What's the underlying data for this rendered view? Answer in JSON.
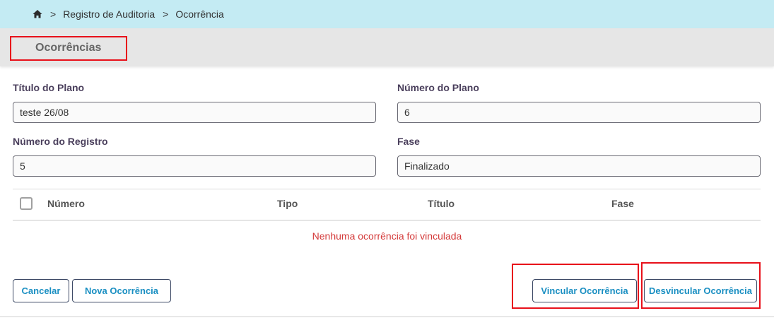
{
  "breadcrumb": {
    "home_icon": "home-icon",
    "separator": ">",
    "items": [
      "Registro de Auditoria",
      "Ocorrência"
    ]
  },
  "section": {
    "title": "Ocorrências"
  },
  "form": {
    "titulo_plano": {
      "label": "Título do Plano",
      "value": "teste 26/08"
    },
    "numero_plano": {
      "label": "Número do Plano",
      "value": "6"
    },
    "numero_registro": {
      "label": "Número do Registro",
      "value": "5"
    },
    "fase": {
      "label": "Fase",
      "value": "Finalizado"
    }
  },
  "table": {
    "columns": [
      "Número",
      "Tipo",
      "Título",
      "Fase"
    ],
    "empty_message": "Nenhuma ocorrência foi vinculada"
  },
  "actions": {
    "cancelar": "Cancelar",
    "nova": "Nova Ocorrência",
    "vincular": "Vincular Ocorrência",
    "desvincular": "Desvincular Ocorrência"
  },
  "colors": {
    "breadcrumb_bg": "#c4ebf3",
    "highlight": "#e8101a",
    "button_text": "#1a8fc2",
    "empty_message": "#d43a3a"
  }
}
